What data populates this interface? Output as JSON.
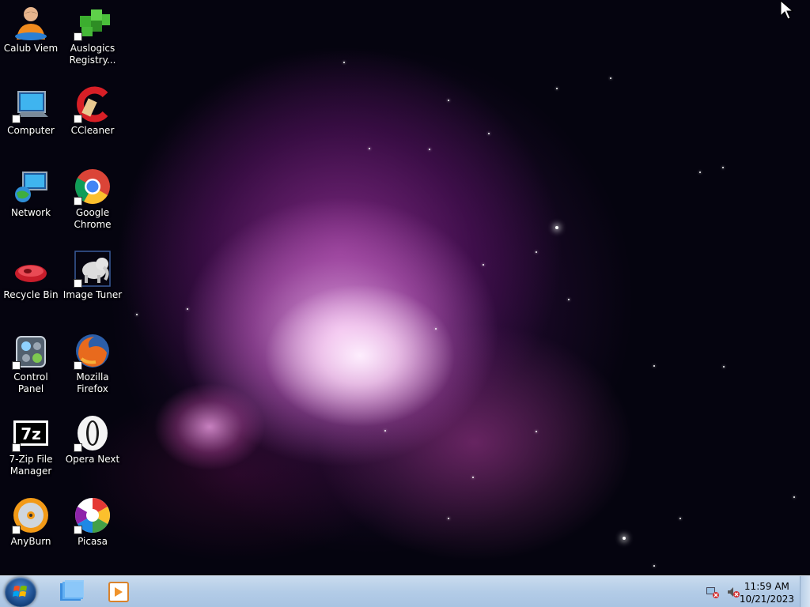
{
  "desktop": {
    "icons": [
      {
        "label_lines": [
          "Calub Viem"
        ],
        "icon": "user-icon"
      },
      {
        "label_lines": [
          "Auslogics",
          "Registry..."
        ],
        "icon": "registry-cleaner-icon"
      },
      {
        "label_lines": [
          "Computer"
        ],
        "icon": "computer-icon"
      },
      {
        "label_lines": [
          "CCleaner"
        ],
        "icon": "ccleaner-icon"
      },
      {
        "label_lines": [
          "Network"
        ],
        "icon": "network-icon"
      },
      {
        "label_lines": [
          "Google",
          "Chrome"
        ],
        "icon": "chrome-icon"
      },
      {
        "label_lines": [
          "Recycle Bin"
        ],
        "icon": "recycle-bin-icon"
      },
      {
        "label_lines": [
          "Image Tuner"
        ],
        "icon": "image-tuner-icon"
      },
      {
        "label_lines": [
          "Control Panel"
        ],
        "icon": "control-panel-icon"
      },
      {
        "label_lines": [
          "Mozilla",
          "Firefox"
        ],
        "icon": "firefox-icon"
      },
      {
        "label_lines": [
          "7-Zip File",
          "Manager"
        ],
        "icon": "7zip-icon"
      },
      {
        "label_lines": [
          "Opera Next"
        ],
        "icon": "opera-icon"
      },
      {
        "label_lines": [
          "AnyBurn"
        ],
        "icon": "anyburn-icon"
      },
      {
        "label_lines": [
          "Picasa"
        ],
        "icon": "picasa-icon"
      }
    ]
  },
  "taskbar": {
    "start_icon": "windows-start-orb",
    "pinned": [
      {
        "icon": "file-explorer-icon"
      },
      {
        "icon": "media-player-icon"
      }
    ],
    "tray": {
      "icons": [
        "network-tray-icon",
        "volume-muted-icon"
      ],
      "time": "11:59 AM",
      "date": "10/21/2023"
    }
  },
  "colors": {
    "taskbar": "#b3cce7",
    "desktop_bg": "#05040f",
    "nebula": "#9a3a9a"
  }
}
